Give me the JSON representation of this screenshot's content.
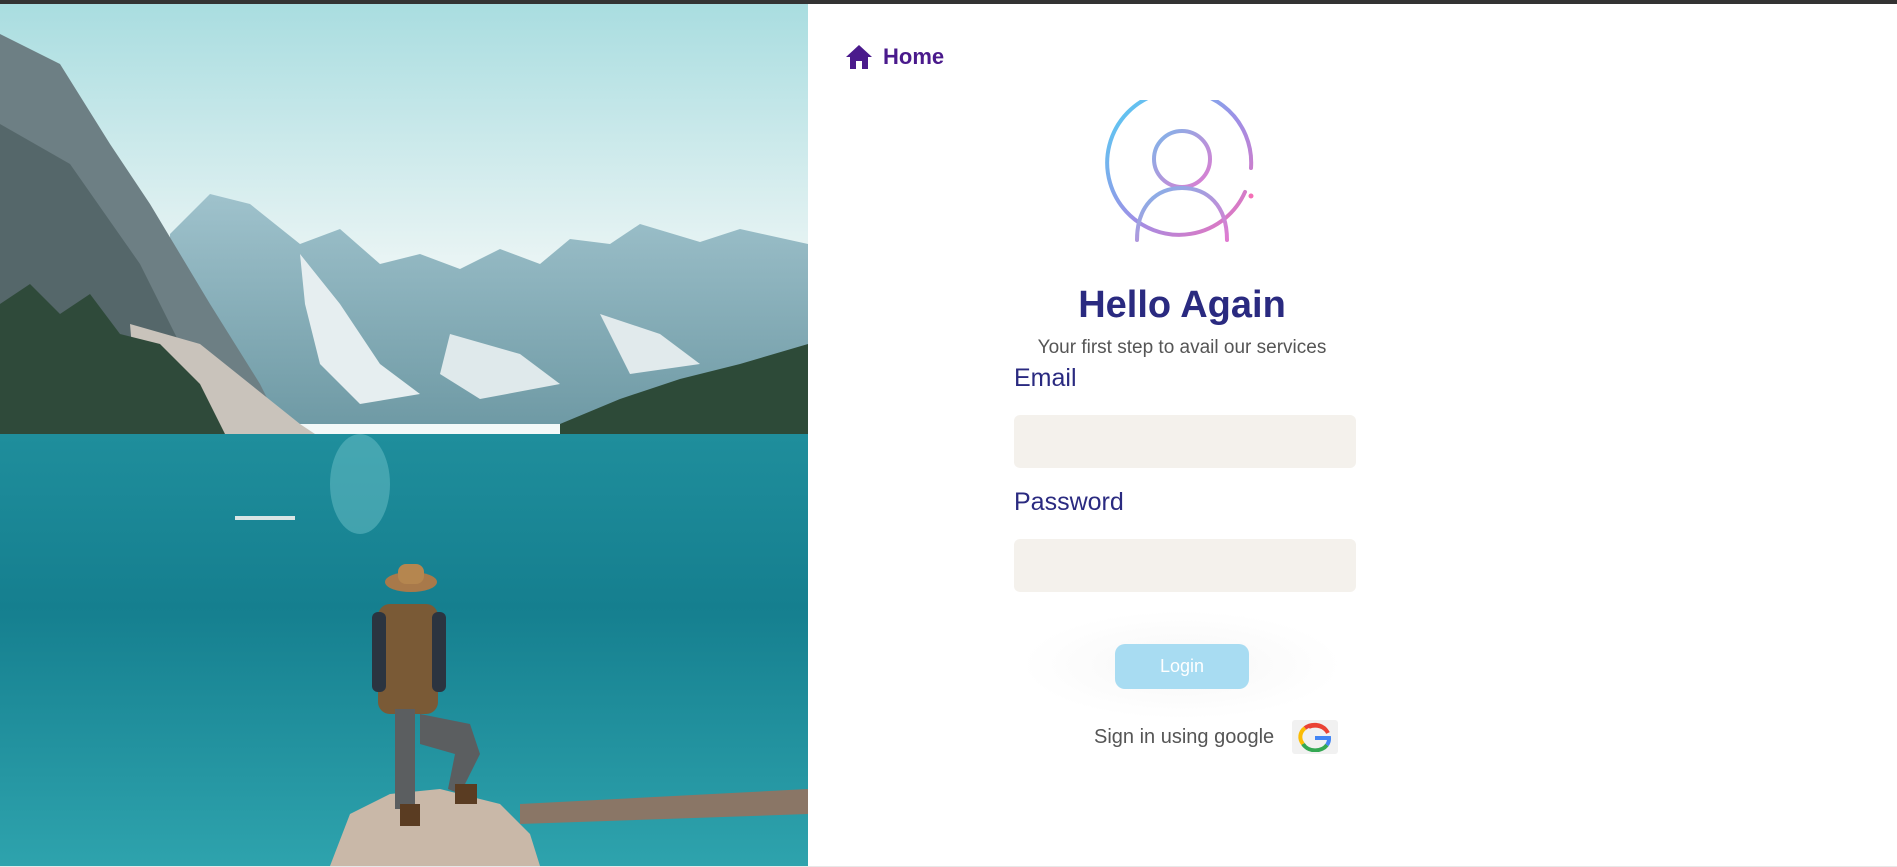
{
  "nav": {
    "home_label": "Home",
    "home_icon": "home-icon"
  },
  "hero": {
    "image": "mountain-lake-photo"
  },
  "login": {
    "avatar_icon": "user-avatar-icon",
    "title": "Hello Again",
    "subtitle": "Your first step to avail our services",
    "email_label": "Email",
    "email_value": "",
    "password_label": "Password",
    "password_value": "",
    "login_button": "Login",
    "google_text": "Sign in using google",
    "google_icon": "google-icon"
  },
  "colors": {
    "accent_dark": "#2a2a80",
    "home_purple": "#4a1a8c",
    "input_bg": "#f4f1ec",
    "button_bg": "#a8dcf2"
  }
}
